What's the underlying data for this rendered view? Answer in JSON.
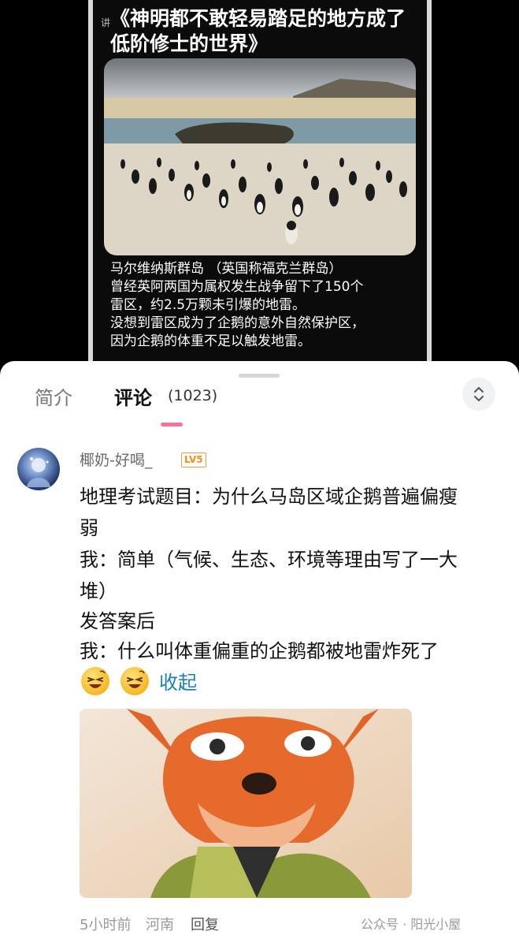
{
  "video": {
    "watermark": "讲",
    "title_line1": "《神明都不敢轻易踏足的地方成了",
    "title_line2": "低阶修士的世界》",
    "caption_lines": [
      "马尔维纳斯群岛 （英国称福克兰群岛）",
      "曾经英阿两国为属权发生战争留下了150个",
      "雷区，约2.5万颗未引爆的地雷。",
      "没想到雷区成为了企鹅的意外自然保护区，",
      "因为企鹅的体重不足以触发地雷。"
    ]
  },
  "tabs": {
    "intro": "简介",
    "comments": "评论",
    "comment_count": "(1023)"
  },
  "comment": {
    "username": "椰奶-好喝_",
    "level": "LV5",
    "lines": [
      "地理考试题目：为什么马岛区域企鹅普遍偏瘦",
      "弱",
      "我：简单（气候、生态、环境等理由写了一大",
      "堆）",
      "发答案后",
      "我：什么叫体重偏重的企鹅都被地雷炸死了"
    ],
    "collapse_label": "收起",
    "time": "5小时前",
    "location": "河南",
    "reply_label": "回复"
  },
  "source_mark": "公众号 · 阳光小屋",
  "colors": {
    "accent_pink": "#fb7299",
    "link_blue": "#1e7fb8",
    "level_orange": "#ff8a1c"
  }
}
